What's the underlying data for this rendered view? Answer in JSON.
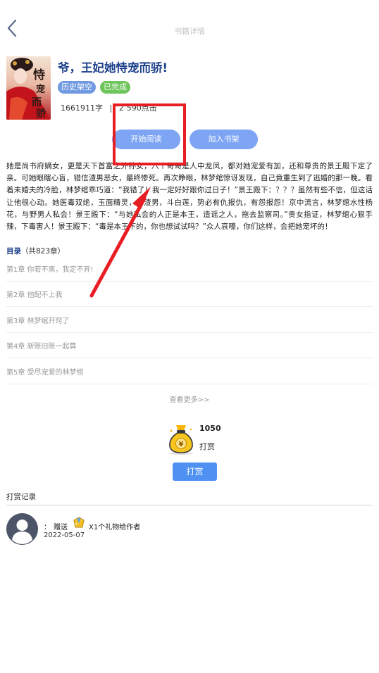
{
  "header": {
    "title": "书籍详情",
    "back_icon": "chevron-left-icon"
  },
  "book": {
    "title": "爷，王妃她恃宠而骄!",
    "tags": [
      {
        "label": "历史架空",
        "color": "#6f99e0"
      },
      {
        "label": "已完成",
        "color": "#6cc45a"
      }
    ],
    "word_count": "1661911字",
    "separator": "|",
    "clicks_partial": "2",
    "clicks_visible_tail": "590点击",
    "cover_text": "恃宠而骄"
  },
  "actions": {
    "start_reading": "开始阅读",
    "add_to_shelf": "加入书架"
  },
  "description": "她是尚书府嫡女，更是天下首富之外孙女，八个哥哥是人中龙凤，都对她宠爱有加，还和尊贵的景王殿下定了亲。可她眼瞎心盲，错信渣男恶女，最终惨死。再次睁眼，林梦绾惊讶发现，自己竟重生到了逃婚的那一晚。看着未婚夫的冷脸，林梦绾乖巧道：“我错了！我一定好好跟你过日子！”景王殿下：？？？虽然有些不信，但这话让他很心动。她医毒双绝，玉面精灵，虐渣男，斗白莲，势必有仇报仇，有怨报怨！京中流言，林梦绾水性杨花，与野男人私会！景王殿下：“与她私会的人正是本王，造谣之人，拖去监察司。”贵女指证，林梦绾心狠手辣，下毒害人！景王殿下：“毒是本王下的，你也想试试吗？”众人哀嚎，你们这样，会把她宠坏的！",
  "toc": {
    "label": "目录",
    "count": "（共823章）",
    "chapters": [
      "第1章 你若不离，我定不弃!",
      "第2章 他配不上我",
      "第3章 林梦绾开窍了",
      "第4章 新账旧账一起算",
      "第5章 受尽宠爱的林梦绾"
    ],
    "more": "查看更多>>"
  },
  "reward": {
    "count": "1050",
    "label": "打赏",
    "button": "打赏",
    "icon": "money-bag-icon",
    "icon_glyph": "¥"
  },
  "records": {
    "title": "打赏记录",
    "items": [
      {
        "prefix": "：",
        "action": "赠送",
        "gift": "X1个礼物给作者",
        "date": "2022-05-07",
        "avatar_icon": "default-avatar-icon",
        "gift_icon": "gift-icon"
      }
    ]
  },
  "colors": {
    "accent": "#7ea5f3",
    "reward_button": "#4e91f3",
    "title": "#1b3f8a",
    "annotation": "#e81e25"
  }
}
